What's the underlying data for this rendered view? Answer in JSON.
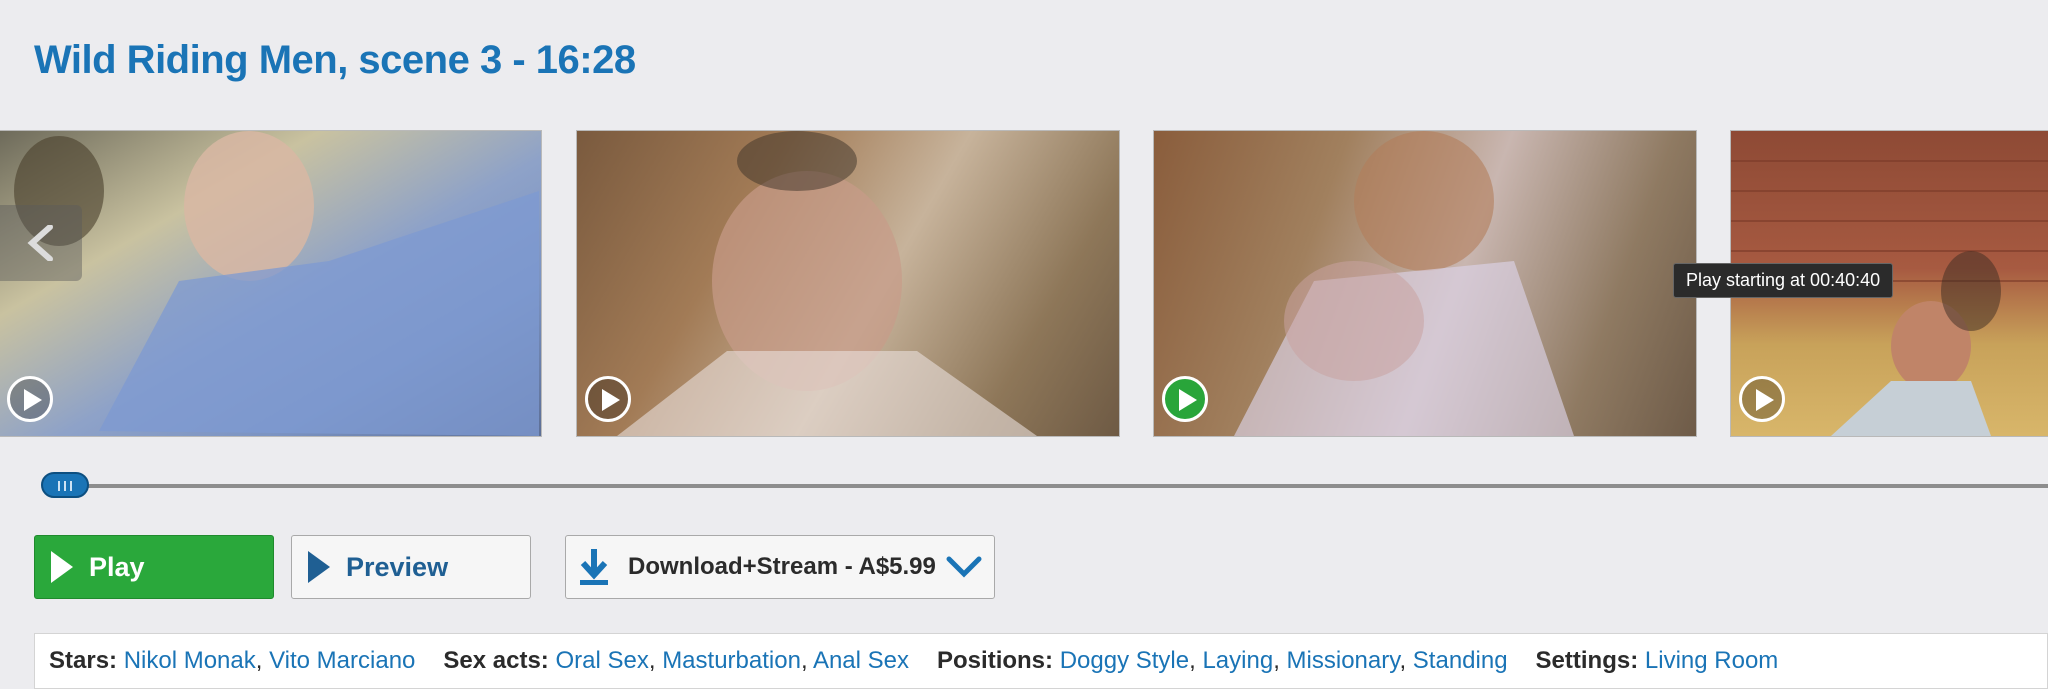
{
  "page": {
    "title": "Wild Riding Men, scene 3 - 16:28"
  },
  "thumbnails": [
    {
      "alt": "scene thumbnail 1",
      "active": false
    },
    {
      "alt": "scene thumbnail 2",
      "active": false
    },
    {
      "alt": "scene thumbnail 3",
      "active": true
    },
    {
      "alt": "scene thumbnail 4",
      "active": false
    }
  ],
  "tooltip": {
    "text": "Play starting at 00:40:40"
  },
  "slider": {
    "position_fraction": 0.0
  },
  "buttons": {
    "play": "Play",
    "preview": "Preview",
    "download": "Download+Stream - A$5.99"
  },
  "meta": {
    "stars": {
      "label": "Stars:",
      "items": [
        "Nikol Monak",
        "Vito Marciano"
      ]
    },
    "sex_acts": {
      "label": "Sex acts:",
      "items": [
        "Oral Sex",
        "Masturbation",
        "Anal Sex"
      ]
    },
    "positions": {
      "label": "Positions:",
      "items": [
        "Doggy Style",
        "Laying",
        "Missionary",
        "Standing"
      ]
    },
    "settings": {
      "label": "Settings:",
      "items": [
        "Living Room"
      ]
    }
  },
  "colors": {
    "accent": "#1a74b6",
    "play_green": "#2aa83b",
    "background": "#ececef"
  },
  "icons": [
    "chevron-left-icon",
    "play-icon",
    "download-icon",
    "chevron-down-icon"
  ]
}
